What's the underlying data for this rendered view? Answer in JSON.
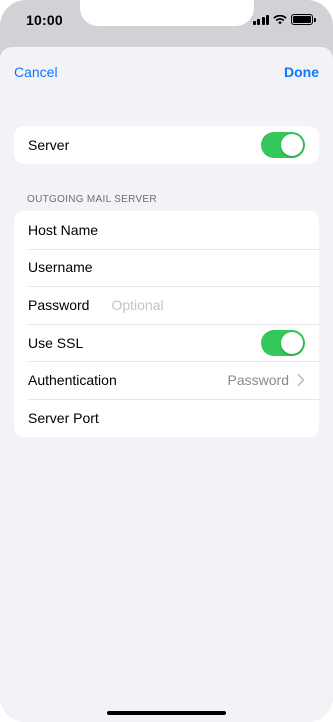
{
  "status_bar": {
    "time": "10:00",
    "signal_icon": "cellular-signal-icon",
    "wifi_icon": "wifi-icon",
    "battery_icon": "battery-icon",
    "battery_level": 1.0
  },
  "nav": {
    "cancel_label": "Cancel",
    "done_label": "Done"
  },
  "server_section": {
    "label": "Server",
    "enabled": true
  },
  "outgoing_section": {
    "header": "OUTGOING MAIL SERVER",
    "host_name": {
      "label": "Host Name",
      "value": ""
    },
    "username": {
      "label": "Username",
      "value": ""
    },
    "password": {
      "label": "Password",
      "placeholder": "Optional"
    },
    "use_ssl": {
      "label": "Use SSL",
      "enabled": true
    },
    "authentication": {
      "label": "Authentication",
      "value": "Password"
    },
    "server_port": {
      "label": "Server Port",
      "value": ""
    }
  },
  "colors": {
    "accent": "#0a7aff",
    "toggle_on": "#34c759",
    "grouped_background": "#f2f2f7"
  }
}
